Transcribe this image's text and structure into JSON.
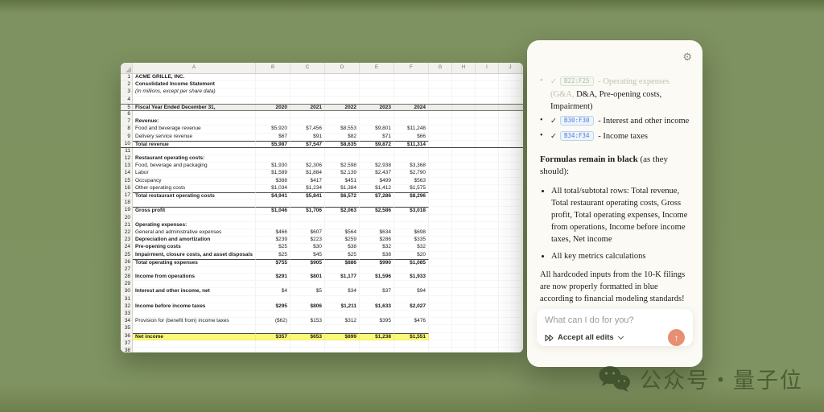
{
  "spreadsheet": {
    "column_letters": [
      "A",
      "B",
      "C",
      "D",
      "E",
      "F",
      "G",
      "H",
      "I",
      "J"
    ],
    "rows": [
      {
        "label": "ACME GRILLE, INC.",
        "ls": "b"
      },
      {
        "label": "Consolidated Income Statement",
        "ls": "b"
      },
      {
        "label": "(In millions, except per share data)",
        "ls": "i"
      },
      {},
      {
        "label": "Fiscal Year Ended December 31,",
        "ls": "b",
        "values": [
          "2020",
          "2021",
          "2022",
          "2023",
          "2024"
        ],
        "vs": "b",
        "cls": "hdr"
      },
      {},
      {
        "label": "Revenue:",
        "ls": "b"
      },
      {
        "label": "Food and beverage revenue",
        "ls": "blue",
        "values": [
          "$5,920",
          "$7,456",
          "$8,553",
          "$9,801",
          "$11,248"
        ],
        "vs": "blue"
      },
      {
        "label": "Delivery service revenue",
        "ls": "blue",
        "values": [
          "$67",
          "$91",
          "$82",
          "$71",
          "$66"
        ],
        "vs": "blue"
      },
      {
        "label": "Total revenue",
        "ls": "b",
        "values": [
          "$5,987",
          "$7,547",
          "$8,635",
          "$9,872",
          "$11,314"
        ],
        "vs": "b",
        "cls": "total underline"
      },
      {},
      {
        "label": "Restaurant operating costs:",
        "ls": "b"
      },
      {
        "label": "Food, beverage and packaging",
        "values": [
          "$1,930",
          "$2,306",
          "$2,598",
          "$2,938",
          "$3,368"
        ],
        "vs": "blue"
      },
      {
        "label": "Labor",
        "values": [
          "$1,589",
          "$1,884",
          "$2,139",
          "$2,437",
          "$2,790"
        ],
        "vs": "blue"
      },
      {
        "label": "Occupancy",
        "values": [
          "$388",
          "$417",
          "$451",
          "$499",
          "$563"
        ],
        "vs": "blue"
      },
      {
        "label": "Other operating costs",
        "values": [
          "$1,034",
          "$1,234",
          "$1,384",
          "$1,412",
          "$1,575"
        ],
        "vs": "blue"
      },
      {
        "label": "Total restaurant operating costs",
        "ls": "b",
        "values": [
          "$4,941",
          "$5,841",
          "$6,572",
          "$7,286",
          "$8,296"
        ],
        "vs": "b",
        "cls": "total"
      },
      {},
      {
        "label": "Gross profit",
        "ls": "b",
        "values": [
          "$1,046",
          "$1,706",
          "$2,063",
          "$2,586",
          "$3,018"
        ],
        "vs": "b",
        "cls": "total"
      },
      {},
      {
        "label": "Operating expenses:",
        "ls": "b"
      },
      {
        "label": "General and administrative expenses",
        "values": [
          "$466",
          "$607",
          "$564",
          "$634",
          "$698"
        ],
        "vs": "blue"
      },
      {
        "label": "Depreciation and amortization",
        "ls": "b",
        "values": [
          "$239",
          "$223",
          "$259",
          "$286",
          "$335"
        ],
        "vs": "blue"
      },
      {
        "label": "Pre-opening costs",
        "ls": "b",
        "values": [
          "$25",
          "$30",
          "$38",
          "$32",
          "$32"
        ],
        "vs": "blue"
      },
      {
        "label": "Impairment, closure costs, and asset disposals",
        "ls": "b",
        "values": [
          "$25",
          "$45",
          "$25",
          "$38",
          "$20"
        ],
        "vs": "blue"
      },
      {
        "label": "Total operating expenses",
        "ls": "b",
        "values": [
          "$755",
          "$905",
          "$886",
          "$990",
          "$1,085"
        ],
        "vs": "b",
        "cls": "total"
      },
      {},
      {
        "label": "Income from operations",
        "ls": "b",
        "values": [
          "$291",
          "$801",
          "$1,177",
          "$1,596",
          "$1,933"
        ],
        "vs": "b"
      },
      {},
      {
        "label": "Interest and other income, net",
        "ls": "b",
        "values": [
          "$4",
          "$5",
          "$34",
          "$37",
          "$94"
        ],
        "vs": "blue"
      },
      {},
      {
        "label": "Income before income taxes",
        "ls": "b",
        "values": [
          "$295",
          "$806",
          "$1,211",
          "$1,633",
          "$2,027"
        ],
        "vs": "b"
      },
      {},
      {
        "label": "Provision for (benefit from) income taxes",
        "values": [
          "($62)",
          "$153",
          "$312",
          "$395",
          "$476"
        ],
        "vs": "blue",
        "vcolors": [
          "red"
        ]
      },
      {},
      {
        "label": "Net income",
        "ls": "b",
        "values": [
          "$357",
          "$653",
          "$899",
          "$1,238",
          "$1,551"
        ],
        "vs": "b",
        "cls": "grand"
      },
      {},
      {}
    ]
  },
  "panel": {
    "checklist": [
      {
        "ref": "B22:F25",
        "faded": true,
        "faded_lead": "- Operating expenses (G&A,",
        "text": "D&A, Pre-opening costs, Impairment)"
      },
      {
        "ref": "B30:F30",
        "text": "- Interest and other income"
      },
      {
        "ref": "B34:F34",
        "text": "- Income taxes"
      }
    ],
    "heading_bold": "Formulas remain in black",
    "heading_rest": " (as they should):",
    "formulas_list": [
      "All total/subtotal rows: Total revenue, Total restaurant operating costs, Gross profit, Total operating expenses, Income from operations, Income before income taxes, Net income",
      "All key metrics calculations"
    ],
    "closing": "All hardcoded inputs from the 10-K filings are now properly formatted in blue according to financial modeling standards!",
    "input_placeholder": "What can I do for you?",
    "accept_label": "Accept all edits"
  },
  "watermark": {
    "text": "公众号・量子位"
  },
  "colors": {
    "background": "#7e9160",
    "input_blue": "#3333cc",
    "negative_red": "#d42a2a",
    "highlight_yellow": "#fbf976",
    "send_button": "#e68f72"
  }
}
